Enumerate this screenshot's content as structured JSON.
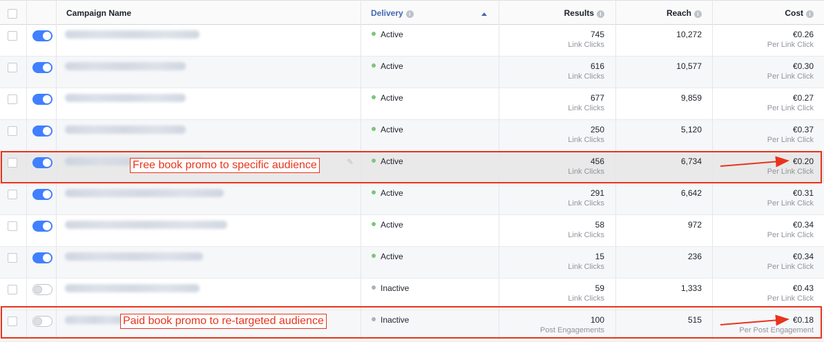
{
  "header": {
    "campaign_name": "Campaign Name",
    "delivery": "Delivery",
    "results": "Results",
    "reach": "Reach",
    "cost": "Cost",
    "info_glyph": "i"
  },
  "rows": [
    {
      "on": true,
      "status": "Active",
      "results": "745",
      "results_type": "Link Clicks",
      "reach": "10,272",
      "cost": "€0.26",
      "cost_type": "Per Link Click"
    },
    {
      "on": true,
      "status": "Active",
      "results": "616",
      "results_type": "Link Clicks",
      "reach": "10,577",
      "cost": "€0.30",
      "cost_type": "Per Link Click"
    },
    {
      "on": true,
      "status": "Active",
      "results": "677",
      "results_type": "Link Clicks",
      "reach": "9,859",
      "cost": "€0.27",
      "cost_type": "Per Link Click"
    },
    {
      "on": true,
      "status": "Active",
      "results": "250",
      "results_type": "Link Clicks",
      "reach": "5,120",
      "cost": "€0.37",
      "cost_type": "Per Link Click"
    },
    {
      "on": true,
      "status": "Active",
      "results": "456",
      "results_type": "Link Clicks",
      "reach": "6,734",
      "cost": "€0.20",
      "cost_type": "Per Link Click"
    },
    {
      "on": true,
      "status": "Active",
      "results": "291",
      "results_type": "Link Clicks",
      "reach": "6,642",
      "cost": "€0.31",
      "cost_type": "Per Link Click"
    },
    {
      "on": true,
      "status": "Active",
      "results": "58",
      "results_type": "Link Clicks",
      "reach": "972",
      "cost": "€0.34",
      "cost_type": "Per Link Click"
    },
    {
      "on": true,
      "status": "Active",
      "results": "15",
      "results_type": "Link Clicks",
      "reach": "236",
      "cost": "€0.34",
      "cost_type": "Per Link Click"
    },
    {
      "on": false,
      "status": "Inactive",
      "results": "59",
      "results_type": "Link Clicks",
      "reach": "1,333",
      "cost": "€0.43",
      "cost_type": "Per Link Click"
    },
    {
      "on": false,
      "status": "Inactive",
      "results": "100",
      "results_type": "Post Engagements",
      "reach": "515",
      "cost": "€0.18",
      "cost_type": "Per Post Engagement"
    }
  ],
  "annotations": {
    "free_promo": "Free book promo to specific audience",
    "paid_promo": "Paid book promo to re-targeted audience"
  },
  "colors": {
    "active": "#7dc57d",
    "inactive": "#aeb1b7",
    "annotation": "#e8341c",
    "toggle_on": "#4080ff"
  },
  "icons": {
    "edit": "pencil-icon",
    "info": "info-icon",
    "sort": "sort-ascending-icon"
  }
}
